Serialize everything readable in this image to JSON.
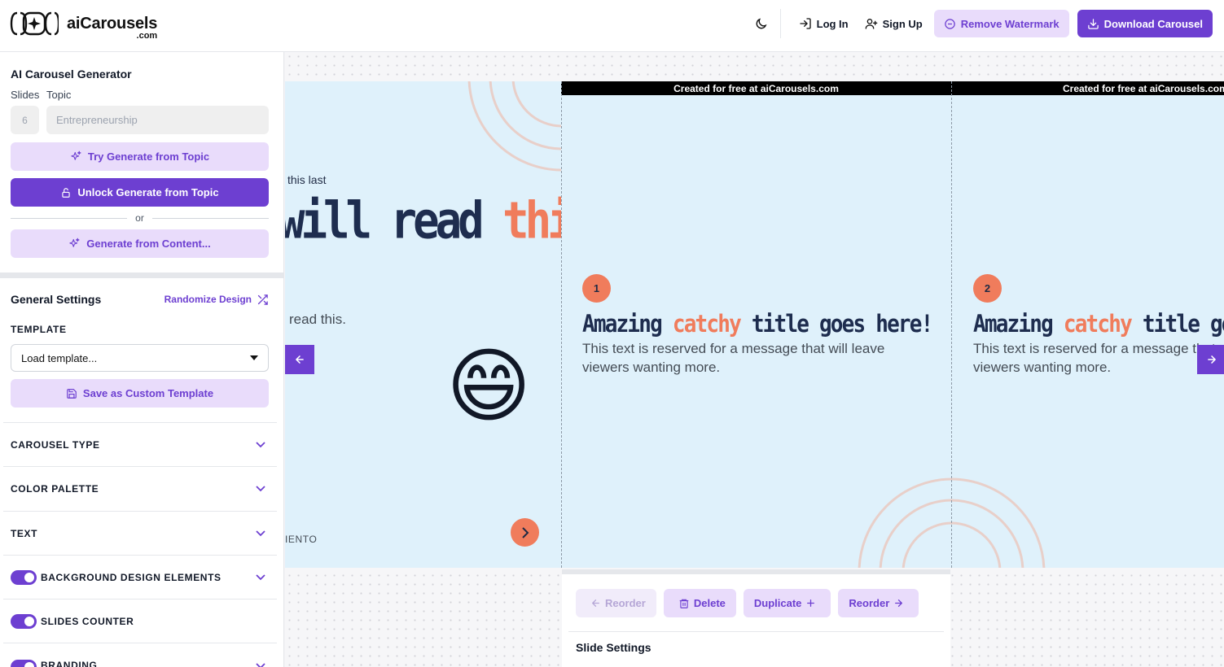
{
  "header": {
    "brand_name": "aiCarousels",
    "brand_suffix": ".com",
    "login_label": "Log In",
    "signup_label": "Sign Up",
    "remove_watermark_label": "Remove Watermark",
    "download_label": "Download Carousel"
  },
  "sidebar": {
    "generator_title": "AI Carousel Generator",
    "slides_label": "Slides",
    "topic_label": "Topic",
    "slides_value": "6",
    "topic_placeholder": "Entrepreneurship",
    "try_generate_label": "Try Generate from Topic",
    "unlock_generate_label": "Unlock Generate from Topic",
    "or_label": "or",
    "generate_content_label": "Generate from Content...",
    "general_settings_title": "General Settings",
    "randomize_label": "Randomize Design",
    "template_label": "TEMPLATE",
    "template_select_value": "Load template...",
    "save_template_label": "Save as Custom Template",
    "accordions": [
      {
        "label": "CAROUSEL TYPE",
        "toggle": false
      },
      {
        "label": "COLOR PALETTE",
        "toggle": false
      },
      {
        "label": "TEXT",
        "toggle": false
      },
      {
        "label": "BACKGROUND DESIGN ELEMENTS",
        "toggle": true,
        "on": true
      },
      {
        "label": "SLIDES COUNTER",
        "toggle": true,
        "on": true
      },
      {
        "label": "BRANDING",
        "toggle": true,
        "on": true
      }
    ]
  },
  "canvas": {
    "watermark_text": "Created for free at aiCarousels.com",
    "intro_slide": {
      "subheading": "this last",
      "title_part1": "will read",
      "title_part2": "this",
      "body": "read this.",
      "footer": "IENTO",
      "emoji": "😄"
    },
    "slide1": {
      "number": "1",
      "title_part1": "Amazing",
      "title_accent": "catchy",
      "title_part2": "title goes here!",
      "body_line1": "This text is reserved for a message that will leave",
      "body_line2": "viewers wanting more."
    },
    "slide2": {
      "number": "2",
      "title_part1": "Amazing",
      "title_accent": "catchy",
      "title_part2": "title goes here!",
      "body_line1": "This text is reserved for a message that will leave",
      "body_line2": "viewers wanting more."
    },
    "toolbar": {
      "reorder_left_label": "Reorder",
      "delete_label": "Delete",
      "duplicate_label": "Duplicate",
      "reorder_right_label": "Reorder",
      "slide_settings_title": "Slide Settings"
    }
  },
  "colors": {
    "brand_purple": "#6d3fd1",
    "brand_light_purple": "#e9dcfb",
    "accent_orange": "#f07c5c",
    "slide_bg": "#dff1fb",
    "title_navy": "#1e2d4f"
  }
}
